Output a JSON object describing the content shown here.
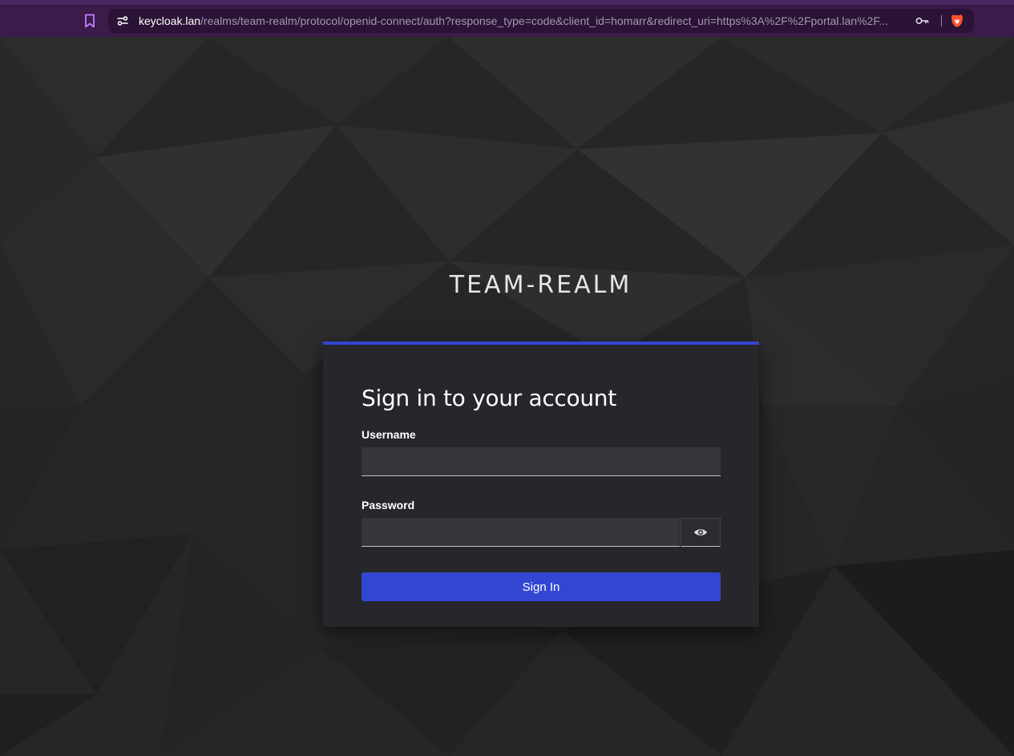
{
  "browser": {
    "url_host": "keycloak.lan",
    "url_path": "/realms/team-realm/protocol/openid-connect/auth?response_type=code&client_id=homarr&redirect_uri=https%3A%2F%2Fportal.lan%2F...",
    "icons": {
      "bookmark": "bookmark-icon",
      "site_info": "site-settings-icon",
      "password_key": "key-icon",
      "shields": "brave-lion-icon"
    },
    "colors": {
      "bar": "#3a1b4a",
      "url_box": "#2a1336",
      "bookmark_accent": "#c77dff",
      "brave_orange": "#fb542b"
    }
  },
  "realm": {
    "name": "TEAM-REALM"
  },
  "login": {
    "title": "Sign in to your account",
    "username_label": "Username",
    "username_value": "",
    "password_label": "Password",
    "password_value": "",
    "show_password_icon": "eye-icon",
    "submit_label": "Sign In"
  },
  "theme": {
    "accent": "#3346d3",
    "card_bg": "#26262b",
    "input_bg": "#35353a",
    "page_bg": "#262626"
  }
}
